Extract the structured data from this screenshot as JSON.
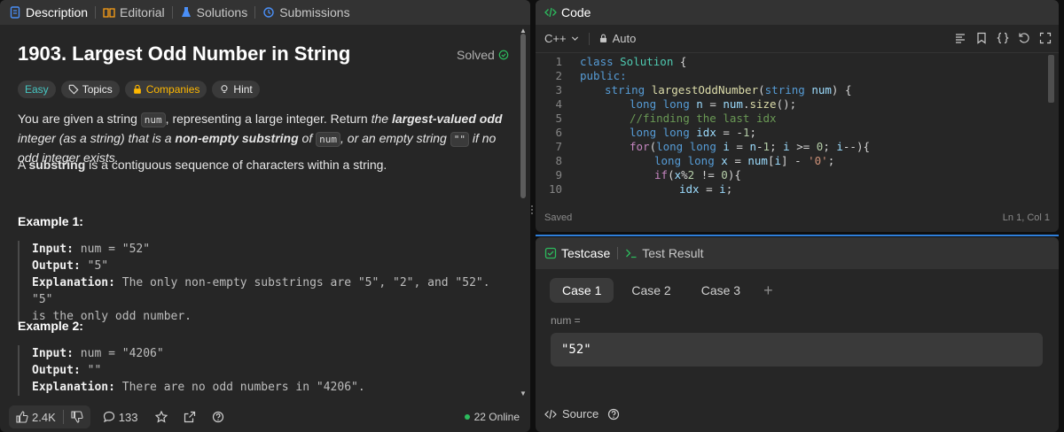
{
  "left_tabs": [
    {
      "label": "Description",
      "color": "#4a8ff7"
    },
    {
      "label": "Editorial",
      "color": "#ffa116"
    },
    {
      "label": "Solutions",
      "color": "#4a8ff7"
    },
    {
      "label": "Submissions",
      "color": "#4a8ff7"
    }
  ],
  "problem": {
    "title": "1903. Largest Odd Number in String",
    "status": "Solved",
    "difficulty": "Easy",
    "tags": [
      "Topics",
      "Companies",
      "Hint"
    ],
    "desc1": {
      "a": "You are given a string ",
      "code1": "num",
      "b": ", representing a large integer. Return ",
      "i1": "the ",
      "bi1": "largest-valued odd",
      "i2": " integer (as a string) that is a ",
      "bi2": "non-empty substring",
      "i3": " of ",
      "code2": "num",
      "i4": ", or an empty string ",
      "code3": "\"\"",
      "i5": " if no odd integer exists."
    },
    "desc2": {
      "a": "A ",
      "b": "substring",
      "c": " is a contiguous sequence of characters within a string."
    },
    "examples": [
      {
        "heading": "Example 1:",
        "input_label": "Input:",
        "input": " num = \"52\"",
        "output_label": "Output:",
        "output": " \"5\"",
        "explanation_label": "Explanation:",
        "explanation_line1": " The only non-empty substrings are \"5\", \"2\", and \"52\". \"5\"",
        "explanation_line2": "is the only odd number."
      },
      {
        "heading": "Example 2:",
        "input_label": "Input:",
        "input": " num = \"4206\"",
        "output_label": "Output:",
        "output": " \"\"",
        "explanation_label": "Explanation:",
        "explanation": " There are no odd numbers in \"4206\"."
      }
    ]
  },
  "bottom_bar": {
    "likes": "2.4K",
    "comments": "133",
    "online": "22 Online"
  },
  "code_panel": {
    "title": "Code",
    "language": "C++",
    "autocomplete": "Auto",
    "status_left": "Saved",
    "status_right": "Ln 1, Col 1",
    "lines": [
      {
        "n": "1"
      },
      {
        "n": "2"
      },
      {
        "n": "3"
      },
      {
        "n": "4"
      },
      {
        "n": "5"
      },
      {
        "n": "6"
      },
      {
        "n": "7"
      },
      {
        "n": "8"
      },
      {
        "n": "9"
      },
      {
        "n": "10"
      }
    ],
    "code_text": {
      "l1a": "class ",
      "l1b": "Solution",
      "l1c": " {",
      "l2": "public:",
      "l3a": "string ",
      "l3b": "largestOddNumber",
      "l3c": "(",
      "l3d": "string ",
      "l3e": "num",
      "l3f": ") {",
      "l4a": "long long ",
      "l4b": "n",
      "l4c": " = ",
      "l4d": "num",
      "l4e": ".",
      "l4f": "size",
      "l4g": "();",
      "l5": "//finding the last idx",
      "l6a": "long long ",
      "l6b": "idx",
      "l6c": " = -",
      "l6d": "1",
      "l6e": ";",
      "l7a": "for",
      "l7b": "(",
      "l7c": "long long ",
      "l7d": "i",
      "l7e": " = ",
      "l7f": "n",
      "l7g": "-",
      "l7h": "1",
      "l7i": "; ",
      "l7j": "i",
      "l7k": " >= ",
      "l7l": "0",
      "l7m": "; ",
      "l7n": "i",
      "l7o": "--){",
      "l8a": "long long ",
      "l8b": "x",
      "l8c": " = ",
      "l8d": "num",
      "l8e": "[",
      "l8f": "i",
      "l8g": "] - ",
      "l8h": "'0'",
      "l8i": ";",
      "l9a": "if",
      "l9b": "(",
      "l9c": "x",
      "l9d": "%",
      "l9e": "2",
      "l9f": " != ",
      "l9g": "0",
      "l9h": "){",
      "l10a": "idx",
      "l10b": " = ",
      "l10c": "i",
      "l10d": ";"
    }
  },
  "test_panel": {
    "tab_testcase": "Testcase",
    "tab_result": "Test Result",
    "cases": [
      "Case 1",
      "Case 2",
      "Case 3"
    ],
    "param_label": "num =",
    "param_value": "\"52\"",
    "source_label": "Source"
  },
  "colors": {
    "accent_blue": "#2f7fda",
    "easy": "#46c6c2",
    "companies": "#ffb800",
    "solved": "#2cbb5d",
    "testcase_green": "#2cbb5d"
  }
}
